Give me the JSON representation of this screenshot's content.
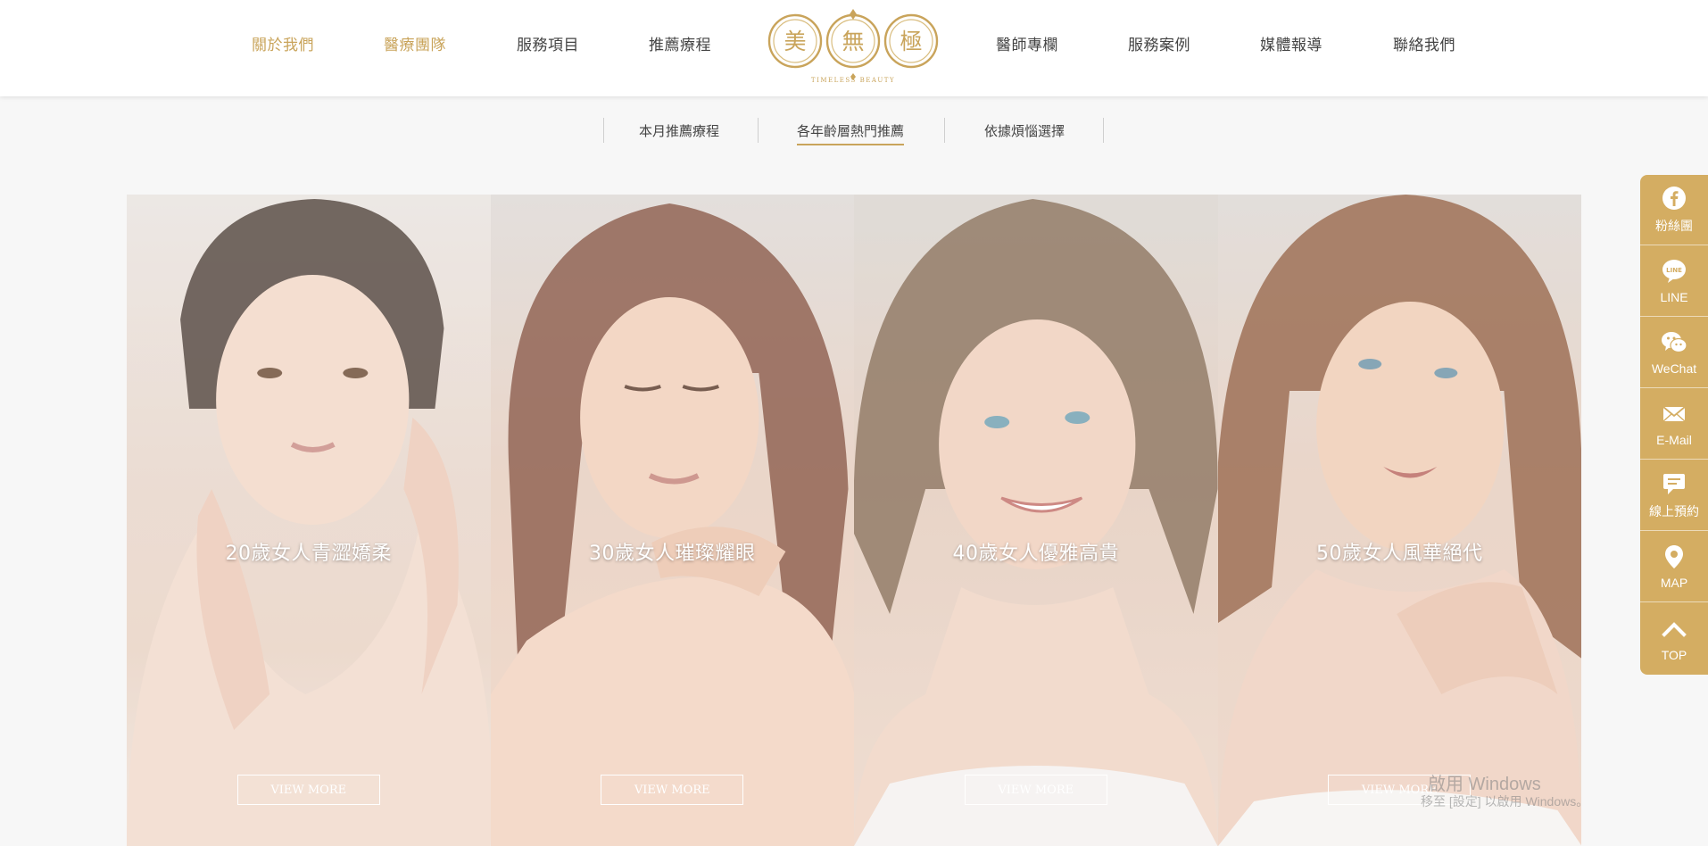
{
  "nav": {
    "left": [
      "關於我們",
      "醫療團隊",
      "服務項目",
      "推薦療程"
    ],
    "right": [
      "醫師專欄",
      "服務案例",
      "媒體報導",
      "聯絡我們"
    ]
  },
  "logo": {
    "chars": [
      "美",
      "無",
      "極"
    ],
    "sub": "TIMELESS BEAUTY"
  },
  "subtabs": {
    "items": [
      "本月推薦療程",
      "各年齡層熱門推薦",
      "依據煩惱選擇"
    ],
    "active_index": 1
  },
  "cards": [
    {
      "title": "20歲女人青澀嬌柔",
      "button": "VIEW MORE"
    },
    {
      "title": "30歲女人璀璨耀眼",
      "button": "VIEW MORE"
    },
    {
      "title": "40歲女人優雅高貴",
      "button": "VIEW MORE"
    },
    {
      "title": "50歲女人風華絕代",
      "button": "VIEW MORE"
    }
  ],
  "sidebar": {
    "items": [
      {
        "label": "粉絲團",
        "icon": "facebook-icon"
      },
      {
        "label": "LINE",
        "icon": "line-icon"
      },
      {
        "label": "WeChat",
        "icon": "wechat-icon"
      },
      {
        "label": "E-Mail",
        "icon": "mail-icon"
      },
      {
        "label": "線上預約",
        "icon": "chat-bubble-icon"
      },
      {
        "label": "MAP",
        "icon": "map-pin-icon"
      },
      {
        "label": "TOP",
        "icon": "chevron-up-icon"
      }
    ]
  },
  "watermark": {
    "line1": "啟用 Windows",
    "line2": "移至 [設定] 以啟用 Windows。"
  },
  "colors": {
    "gold": "#c9a45b",
    "sidebar": "#d4ad62"
  }
}
